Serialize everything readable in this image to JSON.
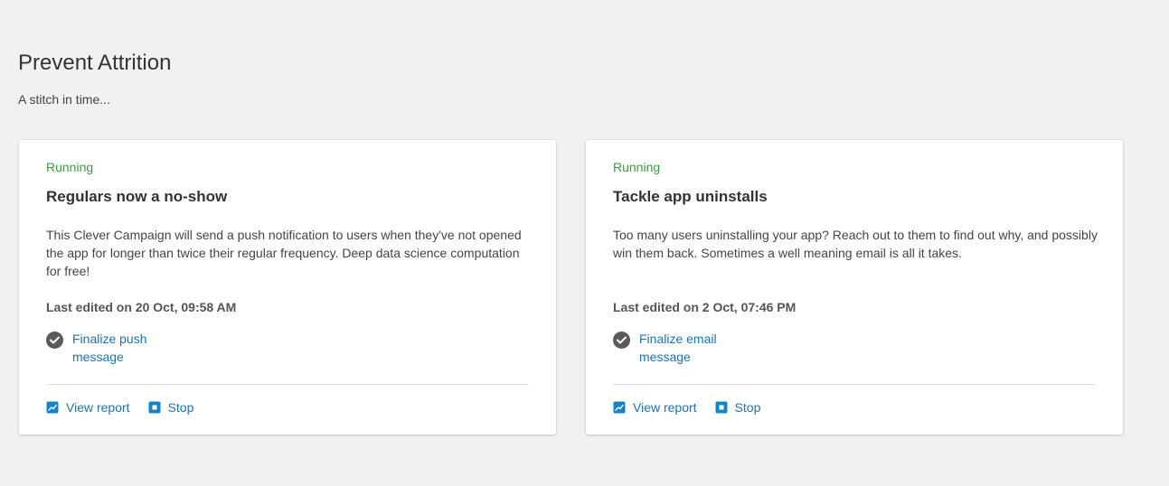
{
  "colors": {
    "running": "#3c9a45",
    "link": "#1a73b8",
    "icon_blue": "#1583c8",
    "check_gray": "#5a5a5a"
  },
  "section": {
    "title": "Prevent Attrition",
    "subtitle": "A stitch in time..."
  },
  "cards": [
    {
      "status": "Running",
      "title": "Regulars now a no-show",
      "description": "This Clever Campaign will send a push notification to users when they've not opened the app for longer than twice their regular frequency. Deep data science computation for free!",
      "last_edited": "Last edited on 20 Oct, 09:58 AM",
      "task_label": "Finalize push message",
      "task_icon": "check-circle-icon",
      "actions": [
        {
          "label": "View report",
          "icon": "chart-icon"
        },
        {
          "label": "Stop",
          "icon": "stop-icon"
        }
      ]
    },
    {
      "status": "Running",
      "title": "Tackle app uninstalls",
      "description": "Too many users uninstalling your app? Reach out to them to find out why, and possibly win them back. Sometimes a well meaning email is all it takes.",
      "last_edited": "Last edited on 2 Oct, 07:46 PM",
      "task_label": "Finalize email message",
      "task_icon": "check-circle-icon",
      "actions": [
        {
          "label": "View report",
          "icon": "chart-icon"
        },
        {
          "label": "Stop",
          "icon": "stop-icon"
        }
      ]
    }
  ]
}
